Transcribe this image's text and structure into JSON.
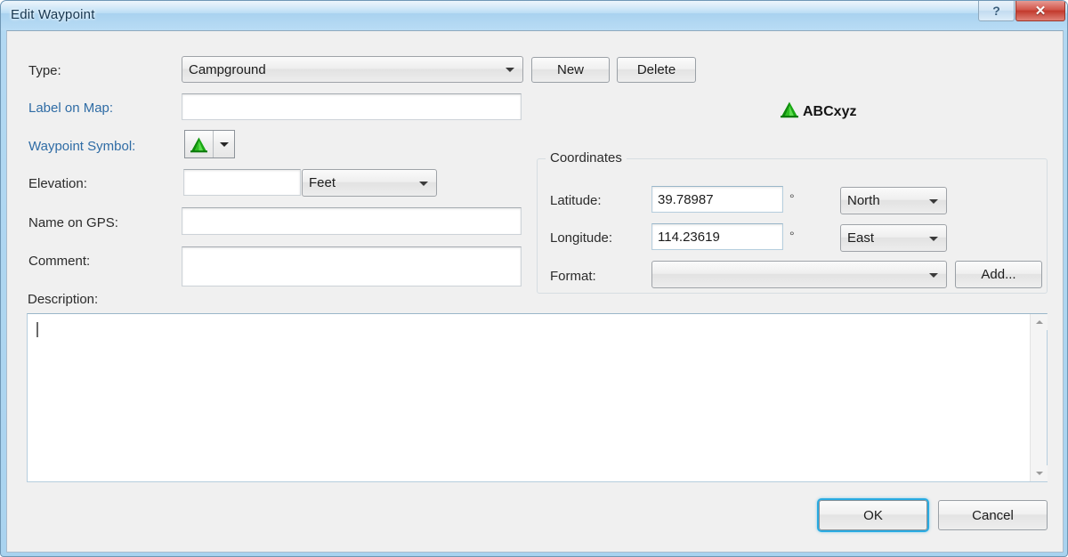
{
  "window": {
    "title": "Edit Waypoint",
    "help_label": "?",
    "close_label": "✕"
  },
  "form": {
    "type_label": "Type:",
    "type_value": "Campground",
    "label_on_map_label": "Label on Map:",
    "label_on_map_value": "",
    "waypoint_symbol_label": "Waypoint Symbol:",
    "waypoint_symbol_icon": "campground-tent-icon",
    "elevation_label": "Elevation:",
    "elevation_value": "",
    "elevation_units_value": "Feet",
    "name_on_gps_label": "Name on GPS:",
    "name_on_gps_value": "",
    "comment_label": "Comment:",
    "comment_value": "",
    "description_label": "Description:",
    "description_value": ""
  },
  "buttons": {
    "new_label": "New",
    "delete_label": "Delete",
    "add_label": "Add...",
    "ok_label": "OK",
    "cancel_label": "Cancel"
  },
  "preview": {
    "icon": "campground-tent-icon",
    "text": "ABCxyz"
  },
  "coordinates": {
    "group_title": "Coordinates",
    "latitude_label": "Latitude:",
    "latitude_value": "39.78987",
    "latitude_degree": "°",
    "latitude_direction": "North",
    "longitude_label": "Longitude:",
    "longitude_value": "114.23619",
    "longitude_degree": "°",
    "longitude_direction": "East",
    "format_label": "Format:",
    "format_value": ""
  },
  "colors": {
    "accent_label": "#2f6ca5",
    "title_bar": "#b6dbf4",
    "default_button_glow": "#29abe2",
    "symbol_green": "#16a012",
    "close_button": "#c23a2d"
  }
}
